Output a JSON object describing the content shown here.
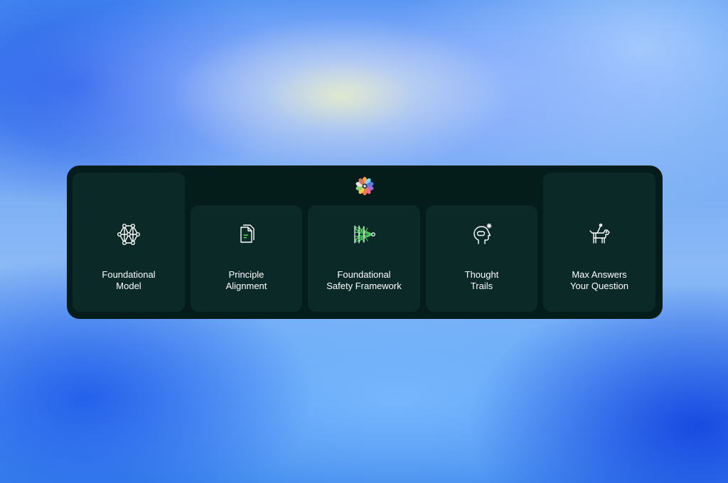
{
  "cards": [
    {
      "line1": "Foundational",
      "line2": "Model",
      "icon": "neural-network-icon"
    },
    {
      "line1": "Principle",
      "line2": "Alignment",
      "icon": "document-icon"
    },
    {
      "line1": "Foundational",
      "line2": "Safety Framework",
      "icon": "safety-network-icon"
    },
    {
      "line1": "Thought",
      "line2": "Trails",
      "icon": "head-thought-icon"
    },
    {
      "line1": "Max Answers",
      "line2": "Your Question",
      "icon": "guide-dog-icon"
    }
  ],
  "colors": {
    "panel": "#041c1a",
    "card": "#0b2a27",
    "text": "#ffffff",
    "icon_accent": "#4ecb5c"
  }
}
